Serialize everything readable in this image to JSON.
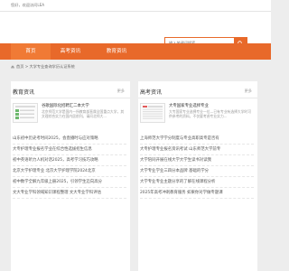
{
  "topbar": {
    "welcome": "您好，欢迎访问LEA"
  },
  "search": {
    "placeholder": "输入关键词搜索"
  },
  "nav": {
    "items": [
      "首页",
      "高考资讯",
      "教育资讯"
    ]
  },
  "breadcrumb": {
    "text": "首页 > 大学专业查询学历认证系统"
  },
  "panels": [
    {
      "title": "教育资讯",
      "more": "更多",
      "feature": {
        "title": "谷歌国际化招聘汇二本大学",
        "summary": "北京师范大学是国内一所教育部直属全国重点大学，其文理综合实力在国内居前列。请问北师大..."
      },
      "items": [
        "山东初中历史考时间2025，会直播时与应对策略",
        "大专护理专业报名学业在综合性选拔招生信息",
        "初中英语听力人机对话2025，高考学习技巧攻略",
        "北京大学护理专业 北京大学护理学院2024北京",
        "初中数学全解九年级上册2025，引领学生迈向高分",
        "文大专业学科领域知识课程整理 文大专业学科评估"
      ]
    },
    {
      "title": "高考资讯",
      "more": "更多",
      "feature": {
        "title": "大专国家专业选择专业",
        "summary": "大专国家专业选择专业一位—已有专业有选择大学时可供参考的资料，不仅要考虑专业实力..."
      },
      "items": [
        "上海师范大学学分制度与专业高职高专是否有",
        "大专护理专业报名资讯考试 山东师范大学前专",
        "大学陪同开展在线大学大学生读书对读我",
        "大学专业学业三四分本品牌 基础的学分",
        "大学专业专业主题分享的了解在线课程分析",
        "2025年高考冲刺教育服务 如果你对学做专题课"
      ]
    }
  ]
}
